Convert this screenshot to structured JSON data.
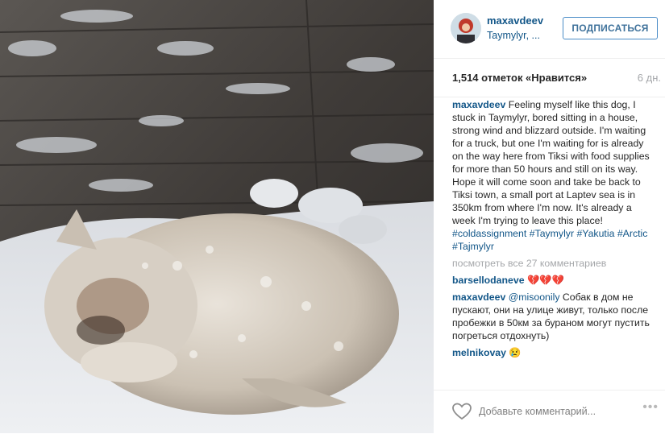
{
  "post": {
    "photo_alt": "",
    "colors": {
      "link": "#125688",
      "meta": "#a5a7aa",
      "border": "#4a8cc7"
    }
  },
  "header": {
    "username": "maxavdeev",
    "location": "Taymylyr, ...",
    "follow_label": "ПОДПИСАТЬСЯ"
  },
  "stats": {
    "likes": "1,514 отметок «Нравится»",
    "age": "6 дн."
  },
  "caption": {
    "username": "maxavdeev",
    "text": " Feeling myself like this dog, I stuck in Taymylyr, bored sitting in a house, strong wind and blizzard outside. I'm waiting for a truck, but one I'm waiting for is already on the way here from Tiksi with food supplies for more than 50 hours and still on its way. Hope it will come soon and take be back to Tiksi town, a small port at Laptev sea is in 350km from where I'm now. It's already a week I'm trying to leave this place! ",
    "tags": [
      "#coldassignment",
      "#Taymylyr",
      "#Yakutia",
      "#Arctic",
      "#Tajmylyr"
    ]
  },
  "view_all": "посмотреть все 27 комментариев",
  "comments": [
    {
      "user": "barsellodaneve",
      "text": " 💔💔💔"
    },
    {
      "user": "maxavdeev",
      "mention": "@misoonily",
      "text": " Собак в дом не пускают, они на улице живут, только после пробежки в 50км за бураном могут пустить погреться отдохнуть)"
    },
    {
      "user": "melnikovay",
      "text": " 😢"
    }
  ],
  "add_comment": {
    "placeholder": "Добавьте комментарий...",
    "more": "•••"
  }
}
